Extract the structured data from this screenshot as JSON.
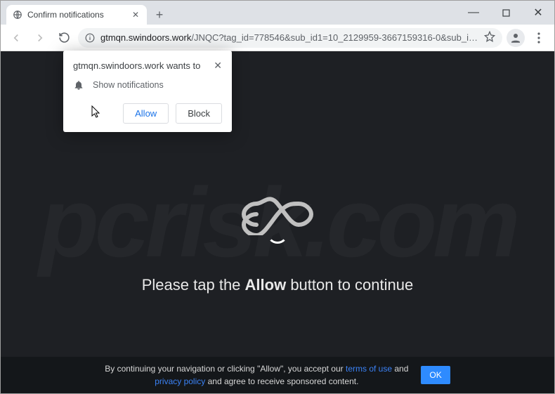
{
  "window": {
    "tab_title": "Confirm notifications",
    "minimize_glyph": "—",
    "maximize_glyph": "▢",
    "close_glyph": "✕",
    "newtab_glyph": "+"
  },
  "toolbar": {
    "url_host": "gtmqn.swindoors.work",
    "url_path": "/JNQC?tag_id=778546&sub_id1=10_2129959-3667159316-0&sub_id2=8475100639014769406&c…"
  },
  "permission": {
    "origin_line": "gtmqn.swindoors.work wants to",
    "request_label": "Show notifications",
    "allow_label": "Allow",
    "block_label": "Block"
  },
  "page": {
    "instruction_pre": "Please tap the ",
    "instruction_bold": "Allow",
    "instruction_post": " button to continue",
    "watermark": "pcrisk.com"
  },
  "cookie": {
    "line1_pre": "By continuing your navigation or clicking \"Allow\", you accept our ",
    "link1": "terms of use",
    "line1_mid": " and ",
    "link2": "privacy policy",
    "line2": " and agree to receive sponsored content.",
    "ok_label": "OK"
  }
}
